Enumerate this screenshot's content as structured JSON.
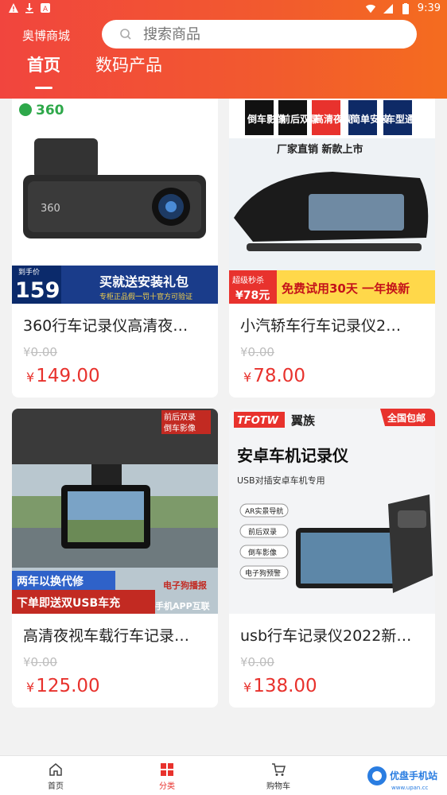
{
  "status_bar": {
    "time": "9:39"
  },
  "header": {
    "store_name": "奥博商城",
    "search_placeholder": "搜索商品",
    "tabs": [
      {
        "label": "首页",
        "active": true
      },
      {
        "label": "数码产品",
        "active": false
      }
    ]
  },
  "products": [
    {
      "title": "360行车记录仪高清夜…",
      "old_price": "0.00",
      "price": "149.00",
      "currency": "¥",
      "image": {
        "brand": "360",
        "label_price": "159",
        "label_top": "到手价",
        "banner": "买就送安装礼包",
        "sub": "专柜正品假一罚十官方可验证"
      }
    },
    {
      "title": "小汽轿车行车记录仪2…",
      "old_price": "0.00",
      "price": "78.00",
      "currency": "¥",
      "image": {
        "tags": [
          "倒车影像",
          "前后双录",
          "高清夜视",
          "简单安装",
          "车型通用"
        ],
        "slogan": "厂家直销  新款上市",
        "promo_tag": "超级秒杀",
        "promo_price": "¥78元",
        "banner": "免费试用30天  一年换新"
      }
    },
    {
      "title": "高清夜视车载行车记录…",
      "old_price": "0.00",
      "price": "125.00",
      "currency": "¥",
      "image": {
        "corner": [
          "前后双录",
          "倒车影像"
        ],
        "line1": "两年以换代修",
        "line2": "下单即送双USB车充",
        "right1": "电子狗播报",
        "right2": "手机APP互联"
      }
    },
    {
      "title": "usb行车记录仪2022新…",
      "old_price": "0.00",
      "price": "138.00",
      "currency": "¥",
      "image": {
        "brand": "TFOTW",
        "brand_cn": "翼族",
        "corner": "全国包邮",
        "heading": "安卓车机记录仪",
        "sub": "USB对插安卓车机专用",
        "features": [
          "AR实景导航",
          "前后双录",
          "倒车影像",
          "电子狗预警"
        ]
      }
    }
  ],
  "bottom_nav": [
    {
      "label": "首页",
      "icon": "home-icon",
      "active": false
    },
    {
      "label": "分类",
      "icon": "category-icon",
      "active": true
    },
    {
      "label": "购物车",
      "icon": "cart-icon",
      "active": false
    }
  ],
  "watermark": {
    "text": "优盘手机站",
    "url": "www.upan.cc"
  },
  "colors": {
    "accent": "#e8322d",
    "header_start": "#f1453e",
    "header_end": "#f46c1f"
  }
}
